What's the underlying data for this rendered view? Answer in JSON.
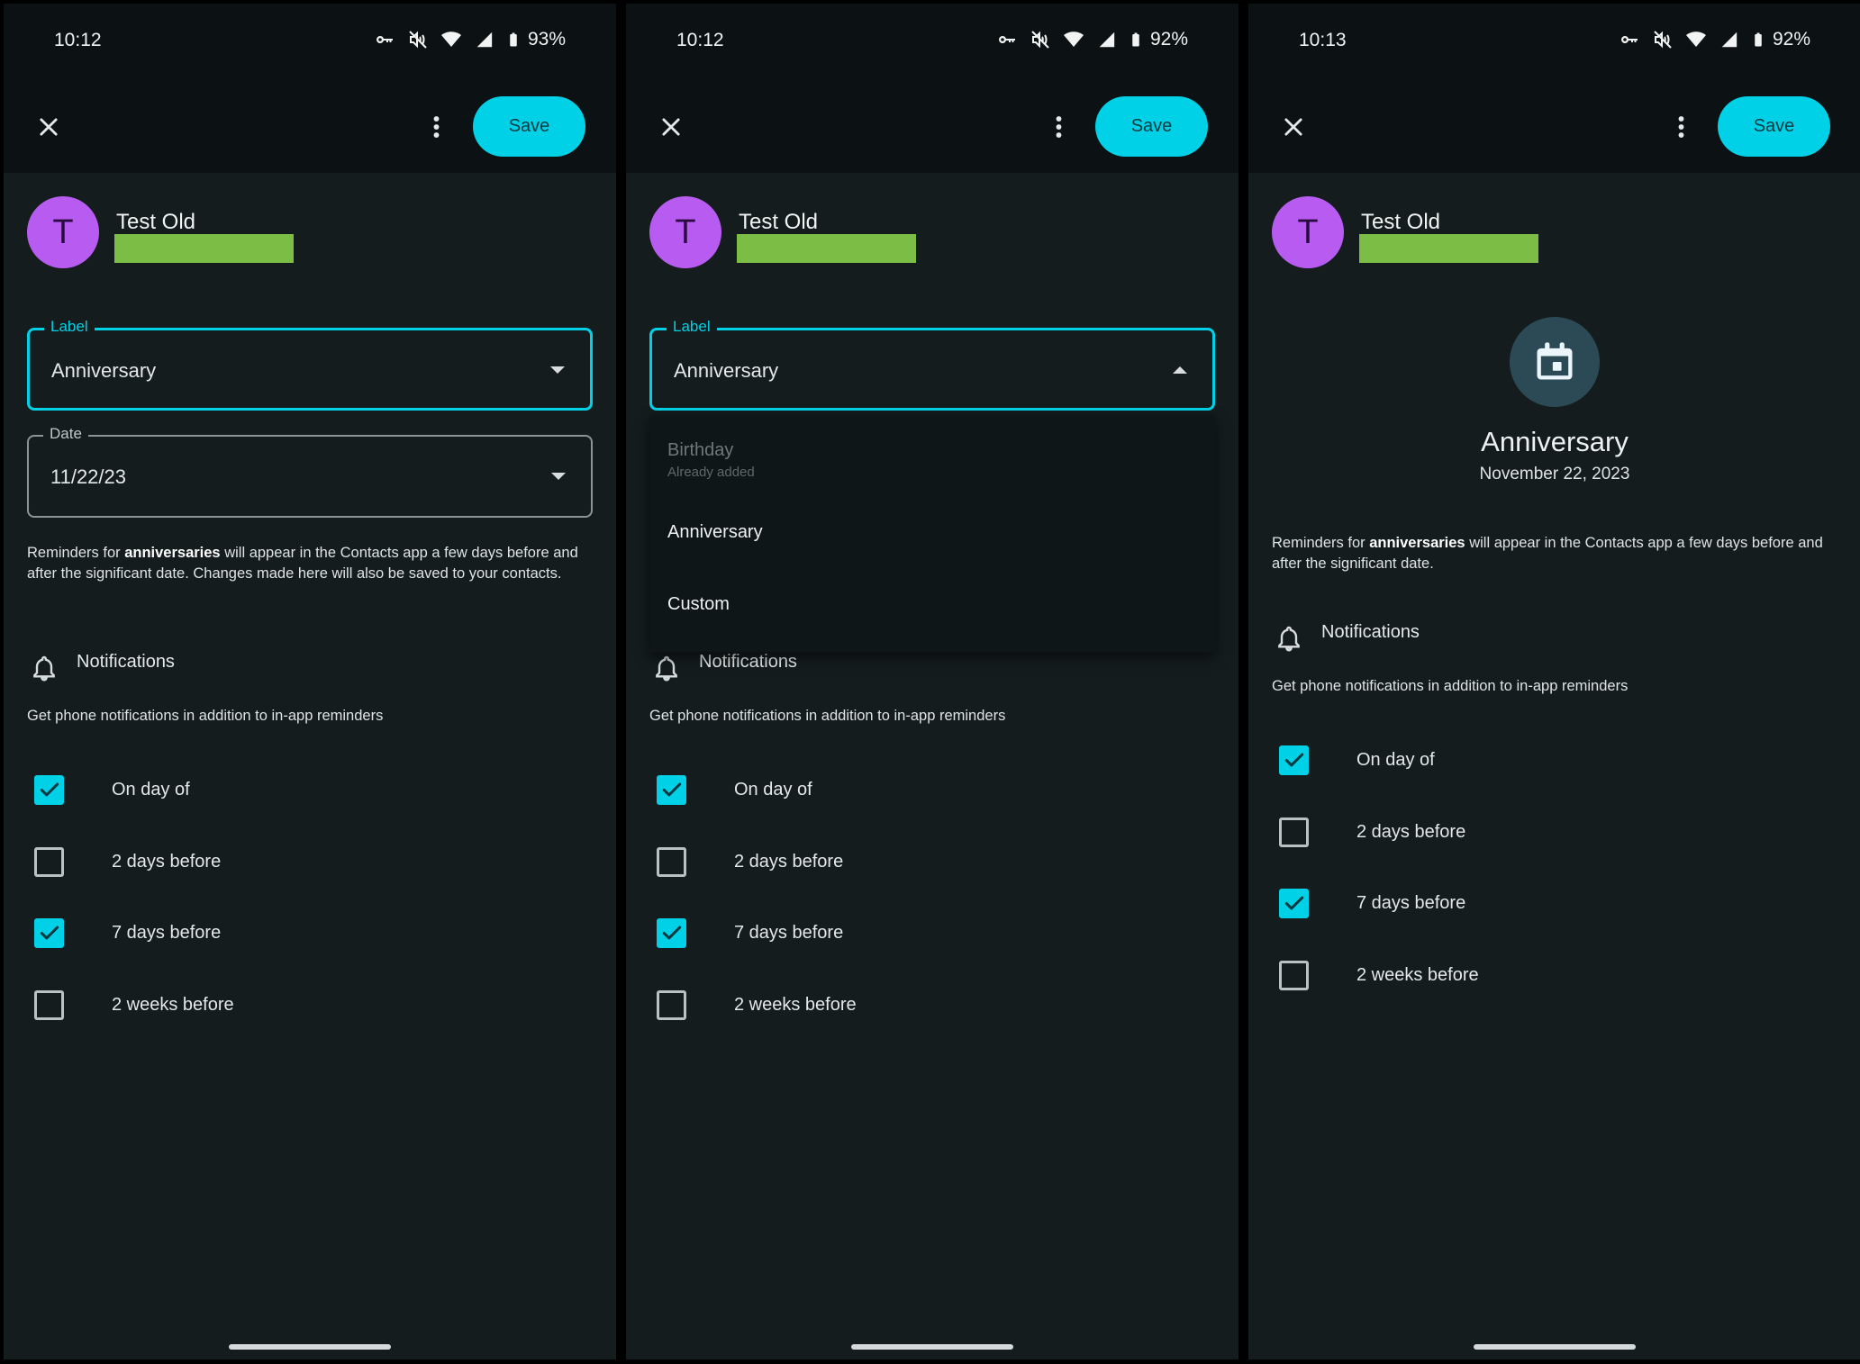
{
  "panels": [
    {
      "status": {
        "time": "10:12",
        "battery": "93%"
      },
      "toolbar": {
        "save_label": "Save"
      },
      "contact": {
        "initial": "T",
        "name": "Test Old"
      },
      "label_field": {
        "legend": "Label",
        "value": "Anniversary"
      },
      "date_field": {
        "legend": "Date",
        "value": "11/22/23"
      },
      "info": {
        "prefix": "Reminders for ",
        "bold": "anniversaries",
        "suffix": " will appear in the Contacts app a few days before and after the significant date. Changes made here will also be saved to your contacts."
      },
      "notifications": {
        "title": "Notifications",
        "subtitle": "Get phone notifications in addition to in-app reminders"
      },
      "options": [
        {
          "label": "On day of",
          "checked": true
        },
        {
          "label": "2 days before",
          "checked": false
        },
        {
          "label": "7 days before",
          "checked": true
        },
        {
          "label": "2 weeks before",
          "checked": false
        }
      ]
    },
    {
      "status": {
        "time": "10:12",
        "battery": "92%"
      },
      "toolbar": {
        "save_label": "Save"
      },
      "contact": {
        "initial": "T",
        "name": "Test Old"
      },
      "label_field": {
        "legend": "Label",
        "value": "Anniversary"
      },
      "dropdown": [
        {
          "label": "Birthday",
          "sub": "Already added",
          "disabled": true
        },
        {
          "label": "Anniversary"
        },
        {
          "label": "Custom"
        }
      ],
      "notifications": {
        "title": "Notifications",
        "subtitle": "Get phone notifications in addition to in-app reminders"
      },
      "options": [
        {
          "label": "On day of",
          "checked": true
        },
        {
          "label": "2 days before",
          "checked": false
        },
        {
          "label": "7 days before",
          "checked": true
        },
        {
          "label": "2 weeks before",
          "checked": false
        }
      ]
    },
    {
      "status": {
        "time": "10:13",
        "battery": "92%"
      },
      "toolbar": {
        "save_label": "Save"
      },
      "contact": {
        "initial": "T",
        "name": "Test Old"
      },
      "event": {
        "title": "Anniversary",
        "date": "November 22, 2023",
        "icon": "calendar-icon"
      },
      "info": {
        "prefix": "Reminders for ",
        "bold": "anniversaries",
        "suffix": " will appear in the Contacts app a few days before and after the significant date."
      },
      "notifications": {
        "title": "Notifications",
        "subtitle": "Get phone notifications in addition to in-app reminders"
      },
      "options": [
        {
          "label": "On day of",
          "checked": true
        },
        {
          "label": "2 days before",
          "checked": false
        },
        {
          "label": "7 days before",
          "checked": true
        },
        {
          "label": "2 weeks before",
          "checked": false
        }
      ]
    }
  ],
  "colors": {
    "accent": "#00d1e6",
    "avatar": "#b85cf1",
    "background": "#141c1e",
    "redaction": "#7cbd45"
  }
}
